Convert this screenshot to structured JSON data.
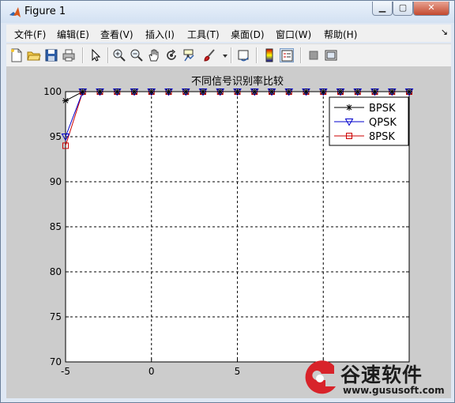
{
  "window": {
    "title": "Figure 1"
  },
  "window_controls": {
    "minimize": "▁",
    "maximize": "▢",
    "close": "✕"
  },
  "menu": {
    "items": [
      "文件(F)",
      "编辑(E)",
      "查看(V)",
      "插入(I)",
      "工具(T)",
      "桌面(D)",
      "窗口(W)",
      "帮助(H)"
    ],
    "overflow_icon": "dock-arrow-icon"
  },
  "toolbar": {
    "icons": [
      "new-figure-icon",
      "open-file-icon",
      "save-icon",
      "print-icon",
      "edit-plot-arrow-icon",
      "zoom-in-icon",
      "zoom-out-icon",
      "pan-hand-icon",
      "rotate-3d-icon",
      "data-cursor-icon",
      "brush-icon",
      "brush-dropdown-icon",
      "link-plot-icon",
      "colorbar-icon",
      "legend-icon",
      "hide-plot-tools-icon",
      "show-plot-tools-icon"
    ]
  },
  "chart_data": {
    "type": "line",
    "title": "不同信号识别率比较",
    "xlabel": "",
    "ylabel": "",
    "xlim": [
      -5,
      15
    ],
    "ylim": [
      70,
      100
    ],
    "xticks": [
      -5,
      0,
      5
    ],
    "yticks": [
      70,
      75,
      80,
      85,
      90,
      95,
      100
    ],
    "grid": true,
    "legend_position": "top-right",
    "x": [
      -5,
      -4,
      -3,
      -2,
      -1,
      0,
      1,
      2,
      3,
      4,
      5,
      6,
      7,
      8,
      9,
      10,
      11,
      12,
      13,
      14,
      15
    ],
    "series": [
      {
        "name": "BPSK",
        "color": "#000000",
        "marker": "star",
        "values": [
          99,
          100,
          100,
          100,
          100,
          100,
          100,
          100,
          100,
          100,
          100,
          100,
          100,
          100,
          100,
          100,
          100,
          100,
          100,
          100,
          100
        ]
      },
      {
        "name": "QPSK",
        "color": "#0000cc",
        "marker": "triangle-down",
        "values": [
          95,
          100,
          100,
          100,
          100,
          100,
          100,
          100,
          100,
          100,
          100,
          100,
          100,
          100,
          100,
          100,
          100,
          100,
          100,
          100,
          100
        ]
      },
      {
        "name": "8PSK",
        "color": "#cc0000",
        "marker": "square",
        "values": [
          94,
          100,
          100,
          100,
          100,
          100,
          100,
          100,
          100,
          100,
          100,
          100,
          100,
          100,
          100,
          100,
          100,
          100,
          100,
          100,
          100
        ]
      }
    ]
  },
  "watermark": {
    "text": "谷速软件",
    "url": "www.gususoft.com",
    "logo_color": "#d8232a"
  }
}
